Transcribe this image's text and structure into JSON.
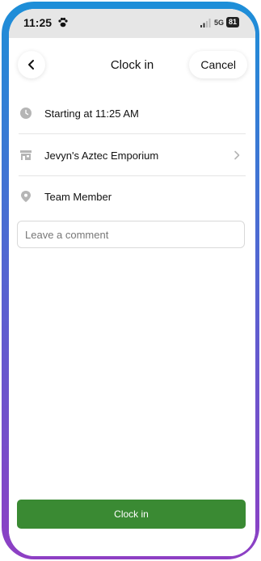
{
  "status_bar": {
    "time": "11:25",
    "network": "5G",
    "battery": "81",
    "icons": [
      "paw-icon",
      "signal-icon"
    ]
  },
  "header": {
    "title": "Clock in",
    "back_icon": "chevron-left-icon",
    "cancel_label": "Cancel"
  },
  "details": {
    "start": {
      "icon": "clock-icon",
      "text": "Starting at 11:25 AM"
    },
    "location": {
      "icon": "store-icon",
      "text": "Jevyn's Aztec Emporium",
      "chevron": "chevron-right-icon"
    },
    "role": {
      "icon": "location-pin-icon",
      "text": "Team Member"
    }
  },
  "comment": {
    "placeholder": "Leave a comment",
    "value": ""
  },
  "footer": {
    "clock_in_label": "Clock in"
  },
  "colors": {
    "primary_button": "#3a8a33",
    "icon_gray": "#b5b5b5",
    "frame_top": "#1d8fd8",
    "frame_bottom": "#8e3fc4"
  }
}
